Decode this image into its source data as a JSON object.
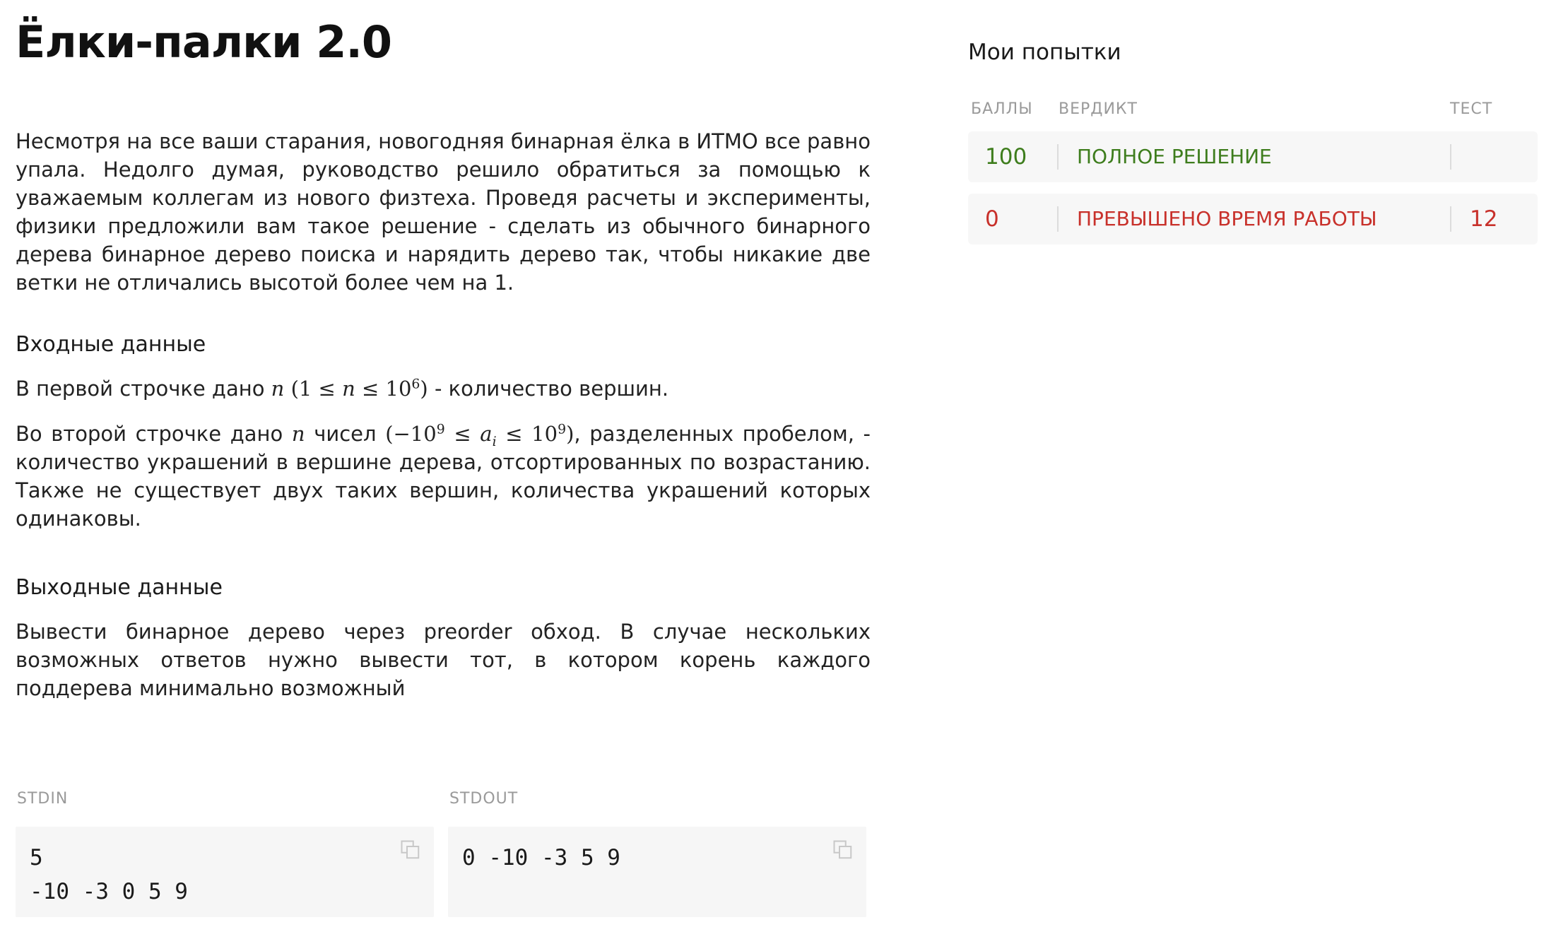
{
  "problem": {
    "title": "Ёлки-палки 2.0",
    "intro": "Несмотря на все ваши старания, новогодняя бинарная ёлка в ИТМО все равно упала. Недолго думая, руководство решило обратиться за помощью к уважаемым коллегам из нового физтеха. Проведя расчеты и эксперименты, физики предложили вам такое решение - сделать из обычного бинарного дерева бинарное дерево поиска и нарядить дерево так, чтобы никакие две ветки не отличались высотой более чем на 1.",
    "input_title": "Входные данные",
    "input_line1_prefix": "В первой строчке дано",
    "input_line1_suffix": " - количество вершин.",
    "input_line2_prefix": "Во второй строчке дано",
    "input_line2_mid": "чисел",
    "input_line2_suffix": ", разделенных пробелом, - количество украшений в вершине дерева, отсортированных по возрастанию. Также не существует двух таких вершин, количества украшений которых одинаковы.",
    "output_title": "Выходные данные",
    "output_text": "Вывести бинарное дерево через preorder обход. В случае нескольких возможных ответов нужно вывести тот, в котором корень каждого поддерева минимально возможный"
  },
  "example": {
    "stdin_label": "STDIN",
    "stdout_label": "STDOUT",
    "stdin": "5\n-10 -3 0 5 9",
    "stdout": "0 -10 -3 5 9"
  },
  "attempts": {
    "title": "Мои попытки",
    "headers": {
      "score": "БАЛЛЫ",
      "verdict": "ВЕРДИКТ",
      "test": "ТЕСТ"
    },
    "rows": [
      {
        "score": "100",
        "verdict": "ПОЛНОЕ РЕШЕНИЕ",
        "test": "",
        "status": "ok",
        "color": "#3e7d1d"
      },
      {
        "score": "0",
        "verdict": "ПРЕВЫШЕНО ВРЕМЯ РАБОТЫ",
        "test": "12",
        "status": "bad",
        "color": "#c8312b"
      }
    ]
  }
}
